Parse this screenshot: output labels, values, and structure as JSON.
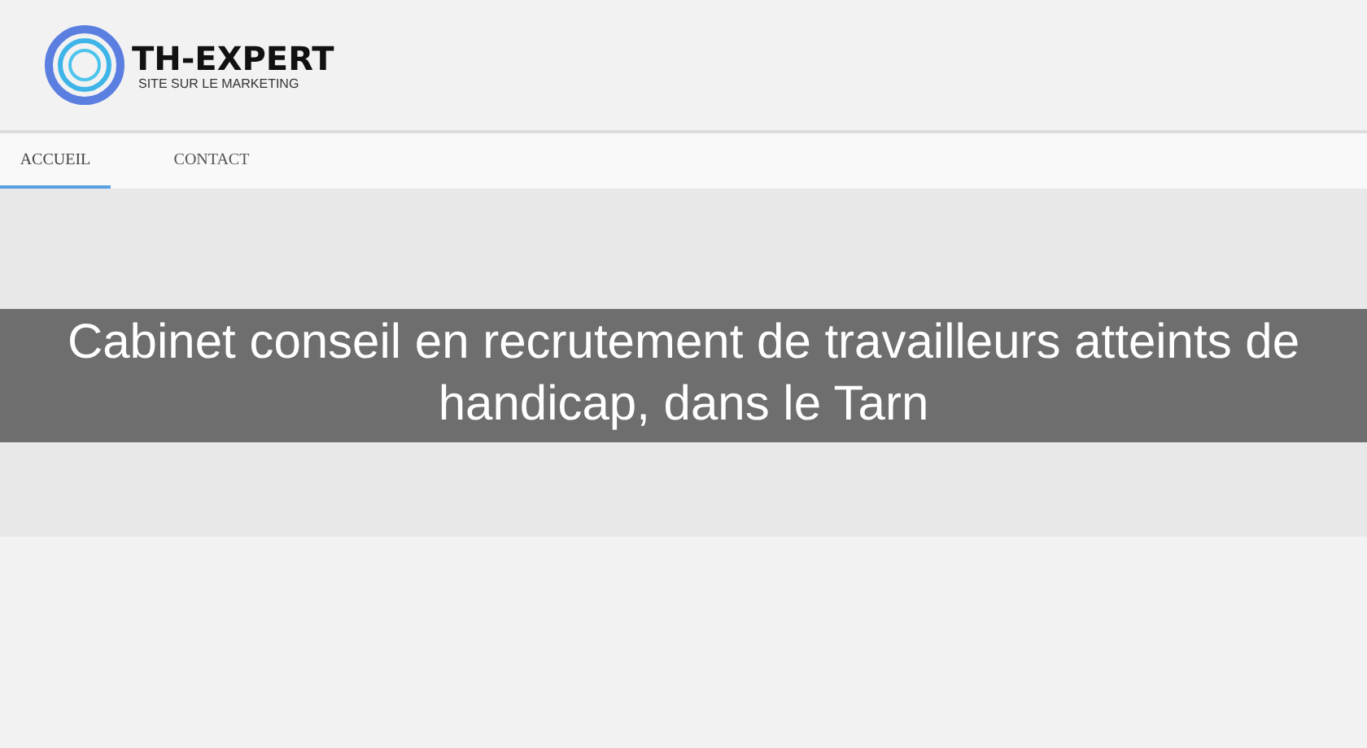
{
  "logo": {
    "name": "TH-EXPERT",
    "tagline": "SITE SUR LE MARKETING"
  },
  "nav": [
    {
      "label": "ACCUEIL",
      "selected": true
    },
    {
      "label": "CONTACT",
      "selected": false
    }
  ],
  "hero": {
    "title": "Cabinet conseil en recrutement de travailleurs atteints de handicap, dans le Tarn"
  }
}
